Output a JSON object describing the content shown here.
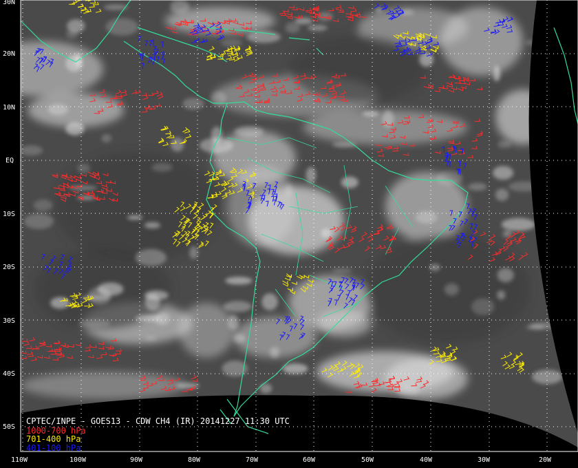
{
  "title": "CPTEC/INPE - GOES13 - CDW CH4 (IR) 20141227 11:30 UTC",
  "legend": [
    {
      "label": "1000-700 hPa",
      "color": "#ff2a2a"
    },
    {
      "label": "701-400 hPa",
      "color": "#ffee00"
    },
    {
      "label": "401-100 hPa",
      "color": "#1a1aff"
    }
  ],
  "latitude_labels": [
    "30N",
    "20N",
    "10N",
    "EQ",
    "10S",
    "20S",
    "30S",
    "40S",
    "50S"
  ],
  "longitude_labels": [
    "110W",
    "100W",
    "90W",
    "80W",
    "70W",
    "60W",
    "50W",
    "40W",
    "30W",
    "20W"
  ],
  "colors": {
    "background": "#000000",
    "coastline": "#33dd99",
    "grid": "#ffffff",
    "cloud_dark": "#3a3a3a",
    "cloud_light": "#dcdcdc"
  }
}
